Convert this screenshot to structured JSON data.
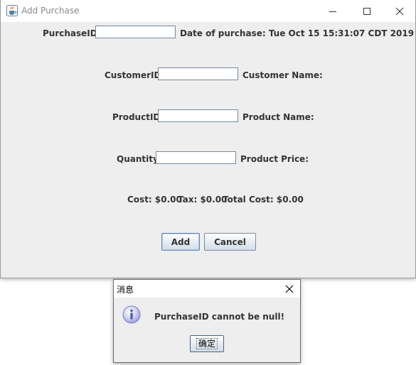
{
  "main_window": {
    "title": "Add Purchase",
    "purchase_id_label": "PurchaseID",
    "purchase_id_value": "",
    "date_of_purchase": "Date of purchase: Tue Oct 15 15:31:07 CDT 2019",
    "customer_id_label": "CustomerID",
    "customer_id_value": "",
    "customer_name_label": "Customer Name:",
    "product_id_label": "ProductID",
    "product_id_value": "",
    "product_name_label": "Product Name:",
    "quantity_label": "Quantity",
    "quantity_value": "",
    "product_price_label": "Product Price:",
    "cost": "Cost: $0.00",
    "tax": "Tax: $0.00",
    "total_cost": "Total Cost: $0.00",
    "add_button": "Add",
    "cancel_button": "Cancel"
  },
  "dialog": {
    "title": "消息",
    "message": "PurchaseID cannot be null!",
    "ok_button": "确定"
  },
  "icons": {
    "app": "java-cup-icon",
    "minimize": "minimize-icon",
    "maximize": "maximize-icon",
    "close": "close-icon",
    "info": "info-icon"
  },
  "colors": {
    "window_bg": "#eeeeee",
    "info_icon": "#8f8fd6"
  }
}
